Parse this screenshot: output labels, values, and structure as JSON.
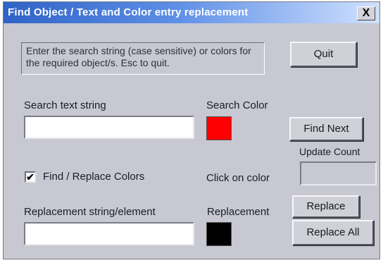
{
  "window": {
    "title": "Find Object / Text and Color entry replacement",
    "close_glyph": "X"
  },
  "instructions": "Enter the search string (case sensitive) or colors for the required object/s. Esc to quit.",
  "buttons": {
    "quit": "Quit",
    "find_next": "Find Next",
    "replace": "Replace",
    "replace_all": "Replace All"
  },
  "search": {
    "label": "Search text string",
    "value": "",
    "color_label": "Search Color",
    "color": "#ff0000"
  },
  "update_count": {
    "label": "Update Count",
    "value": ""
  },
  "find_replace_colors": {
    "label": "Find / Replace Colors",
    "checked": true,
    "check_glyph": "✔"
  },
  "color_hint": "Click on color",
  "replacement": {
    "label": "Replacement string/element",
    "value": "",
    "color_label": "Replacement",
    "color": "#000000"
  }
}
